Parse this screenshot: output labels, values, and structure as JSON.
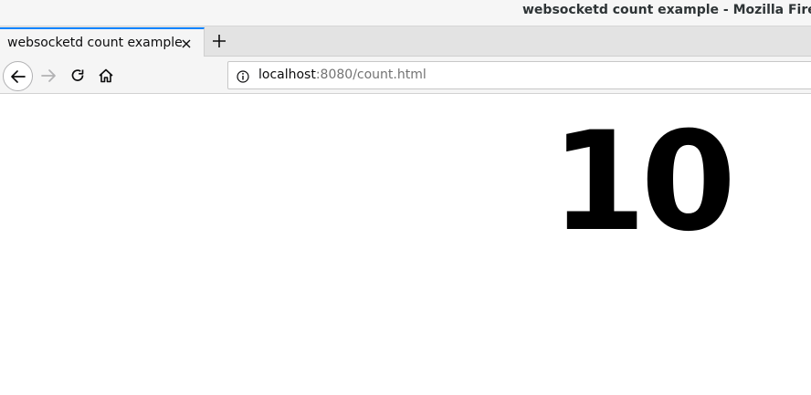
{
  "window": {
    "title": "websocketd count example - Mozilla Firefox"
  },
  "tabs": [
    {
      "label": "websocketd count example",
      "active": true
    }
  ],
  "icons": {
    "tab_close": "close-icon",
    "new_tab": "plus-icon",
    "back": "arrow-left-icon",
    "forward": "arrow-right-icon",
    "reload": "reload-icon",
    "home": "home-icon",
    "site_info": "info-icon"
  },
  "urlbar": {
    "host": "localhost",
    "rest": ":8080/count.html"
  },
  "page": {
    "count": "10"
  },
  "colors": {
    "tab_accent": "#0a84ff",
    "disabled": "#b1b1b3"
  }
}
